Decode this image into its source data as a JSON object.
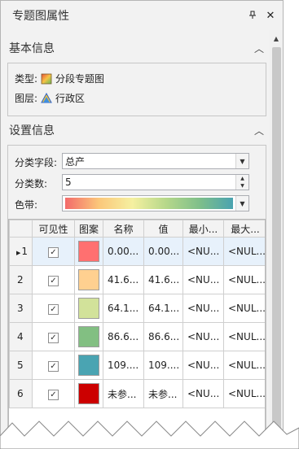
{
  "panel": {
    "title": "专题图属性",
    "pin_icon": "pin-icon",
    "close_icon": "close-icon"
  },
  "basic_info": {
    "header": "基本信息",
    "type_label": "类型:",
    "type_value": "分段专题图",
    "type_icon": "range-theme-icon",
    "layer_label": "图层:",
    "layer_value": "行政区",
    "layer_icon": "region-layer-icon"
  },
  "settings": {
    "header": "设置信息",
    "field_label": "分类字段:",
    "field_value": "总产",
    "count_label": "分类数:",
    "count_value": "5",
    "ramp_label": "色带:",
    "ramp_colors": [
      "#f36a6a",
      "#fbc77a",
      "#f5f0a0",
      "#b6d88a",
      "#7fbf8a",
      "#4aa3b0"
    ]
  },
  "grid": {
    "columns": [
      "",
      "可见性",
      "图案",
      "名称",
      "值",
      "最小...",
      "最大..."
    ],
    "rows": [
      {
        "index": "1",
        "visible": true,
        "color": "#ff7070",
        "name": "0.00...",
        "value": "0.00...",
        "min": "<NU...",
        "max": "<NUL..."
      },
      {
        "index": "2",
        "visible": true,
        "color": "#ffd090",
        "name": "41.6...",
        "value": "41.6...",
        "min": "<NU...",
        "max": "<NUL..."
      },
      {
        "index": "3",
        "visible": true,
        "color": "#d2e29a",
        "name": "64.1...",
        "value": "64.1...",
        "min": "<NU...",
        "max": "<NUL..."
      },
      {
        "index": "4",
        "visible": true,
        "color": "#82bf82",
        "name": "86.6...",
        "value": "86.6...",
        "min": "<NU...",
        "max": "<NUL..."
      },
      {
        "index": "5",
        "visible": true,
        "color": "#4aa4b2",
        "name": "109....",
        "value": "109....",
        "min": "<NU...",
        "max": "<NUL..."
      },
      {
        "index": "6",
        "visible": true,
        "color": "#cc0000",
        "name": "未参...",
        "value": "未参...",
        "min": "<NU...",
        "max": "<NUL..."
      }
    ]
  }
}
